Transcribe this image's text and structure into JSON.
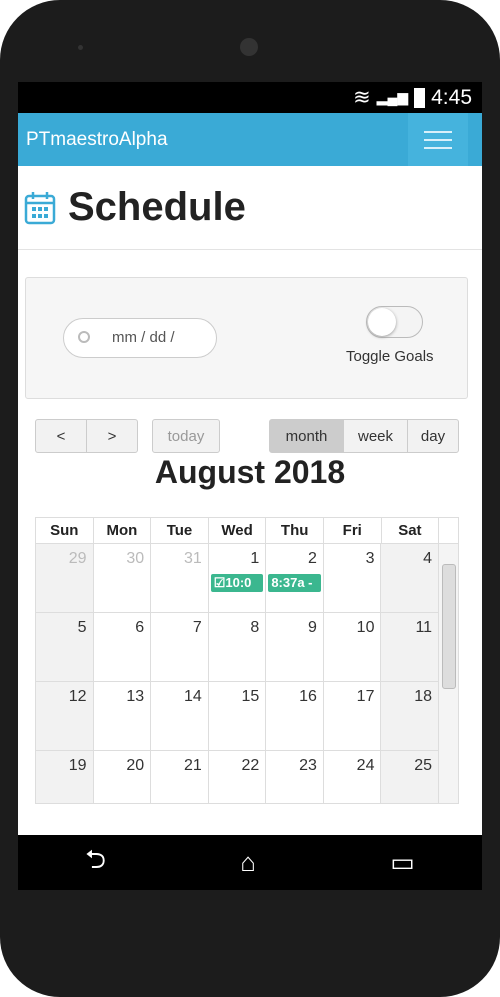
{
  "status": {
    "time": "4:45",
    "icons": [
      "wifi-icon",
      "signal-icon",
      "battery-icon"
    ]
  },
  "appbar": {
    "title": "PTmaestroAlpha",
    "menu_icon": "hamburger-icon"
  },
  "page": {
    "title": "Schedule",
    "icon": "calendar-icon"
  },
  "filters": {
    "date_placeholder": "mm / dd /",
    "toggle_label": "Toggle Goals",
    "toggle_on": false
  },
  "toolbar": {
    "prev": "<",
    "next": ">",
    "today": "today",
    "views": [
      "month",
      "week",
      "day"
    ],
    "active_view": "month"
  },
  "calendar": {
    "title": "August 2018",
    "weekdays": [
      "Sun",
      "Mon",
      "Tue",
      "Wed",
      "Thu",
      "Fri",
      "Sat"
    ],
    "weeks": [
      [
        "29",
        "30",
        "31",
        "1",
        "2",
        "3",
        "4"
      ],
      [
        "5",
        "6",
        "7",
        "8",
        "9",
        "10",
        "11"
      ],
      [
        "12",
        "13",
        "14",
        "15",
        "16",
        "17",
        "18"
      ],
      [
        "19",
        "20",
        "21",
        "22",
        "23",
        "24",
        "25"
      ]
    ],
    "events": [
      {
        "day": "1",
        "label": "10:0",
        "icon": "check-icon"
      },
      {
        "day": "2",
        "label": "8:37a -"
      }
    ],
    "event_color": "#3bb78f"
  },
  "accent": "#3aaad6",
  "nav": {
    "back": "back-icon",
    "home": "home-icon",
    "recents": "recents-icon"
  }
}
